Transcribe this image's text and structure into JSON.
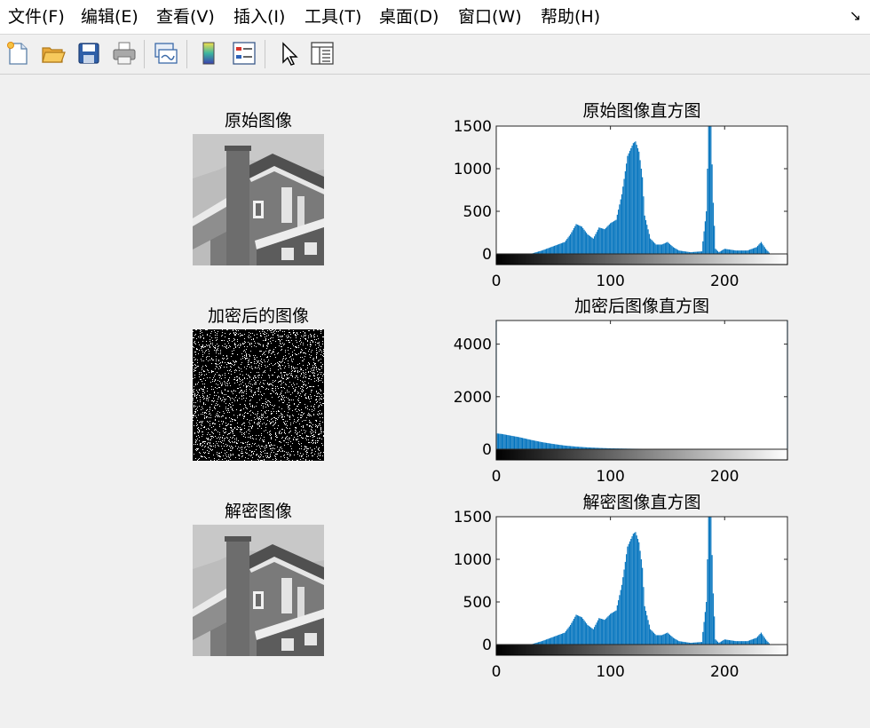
{
  "window": {
    "menus": [
      "文件(F)",
      "编辑(E)",
      "查看(V)",
      "插入(I)",
      "工具(T)",
      "桌面(D)",
      "窗口(W)",
      "帮助(H)"
    ],
    "dock_glyph": "↘"
  },
  "toolbar": {
    "buttons": [
      "new-figure",
      "open-file",
      "save",
      "print",
      "link-plot",
      "insert-colorbar",
      "insert-legend",
      "edit-plot-pointer",
      "property-inspector"
    ]
  },
  "images": {
    "original_title": "原始图像",
    "encrypted_title": "加密后的图像",
    "decrypted_title": "解密图像"
  },
  "chart_data": [
    {
      "type": "bar",
      "title": "原始图像直方图",
      "xlim": [
        0,
        255
      ],
      "ylim": [
        0,
        1500
      ],
      "xticks": [
        "0",
        "100",
        "200"
      ],
      "yticks": [
        "0",
        "500",
        "1000",
        "1500"
      ],
      "bar_color": "#0072BD",
      "colorbar": "grayscale 0-255",
      "x": [
        30,
        40,
        50,
        60,
        65,
        70,
        75,
        80,
        85,
        90,
        95,
        100,
        105,
        110,
        115,
        120,
        122,
        125,
        128,
        130,
        135,
        140,
        145,
        150,
        155,
        160,
        170,
        180,
        184,
        186,
        188,
        190,
        192,
        195,
        200,
        210,
        220,
        228,
        232,
        236,
        240
      ],
      "values": [
        0,
        40,
        90,
        140,
        230,
        350,
        320,
        230,
        180,
        310,
        290,
        360,
        400,
        700,
        1150,
        1300,
        1320,
        1200,
        900,
        450,
        180,
        110,
        110,
        140,
        80,
        40,
        20,
        30,
        500,
        1500,
        1500,
        600,
        60,
        20,
        60,
        40,
        40,
        80,
        140,
        60,
        0
      ]
    },
    {
      "type": "bar",
      "title": "加密后图像直方图",
      "xlim": [
        0,
        255
      ],
      "ylim": [
        0,
        4900
      ],
      "xticks": [
        "0",
        "100",
        "200"
      ],
      "yticks": [
        "0",
        "2000",
        "4000"
      ],
      "bar_color": "#0072BD",
      "colorbar": "grayscale 0-255",
      "x": [
        0,
        1,
        5,
        10,
        20,
        30,
        40,
        50,
        60,
        70,
        80,
        90,
        100,
        120,
        140,
        160,
        180,
        200,
        220,
        240,
        254,
        255
      ],
      "values": [
        4900,
        600,
        580,
        540,
        460,
        360,
        270,
        200,
        140,
        100,
        70,
        50,
        35,
        20,
        12,
        8,
        5,
        3,
        2,
        1,
        1,
        4900
      ]
    },
    {
      "type": "bar",
      "title": "解密图像直方图",
      "xlim": [
        0,
        255
      ],
      "ylim": [
        0,
        1500
      ],
      "xticks": [
        "0",
        "100",
        "200"
      ],
      "yticks": [
        "0",
        "500",
        "1000",
        "1500"
      ],
      "bar_color": "#0072BD",
      "colorbar": "grayscale 0-255",
      "x": [
        30,
        40,
        50,
        60,
        65,
        70,
        75,
        80,
        85,
        90,
        95,
        100,
        105,
        110,
        115,
        120,
        122,
        125,
        128,
        130,
        135,
        140,
        145,
        150,
        155,
        160,
        170,
        180,
        184,
        186,
        188,
        190,
        192,
        195,
        200,
        210,
        220,
        228,
        232,
        236,
        240
      ],
      "values": [
        0,
        40,
        90,
        140,
        230,
        350,
        320,
        230,
        180,
        310,
        290,
        360,
        400,
        700,
        1150,
        1300,
        1320,
        1200,
        900,
        450,
        180,
        110,
        110,
        140,
        80,
        40,
        20,
        30,
        500,
        1500,
        1500,
        600,
        60,
        20,
        60,
        40,
        40,
        80,
        140,
        60,
        0
      ]
    }
  ]
}
